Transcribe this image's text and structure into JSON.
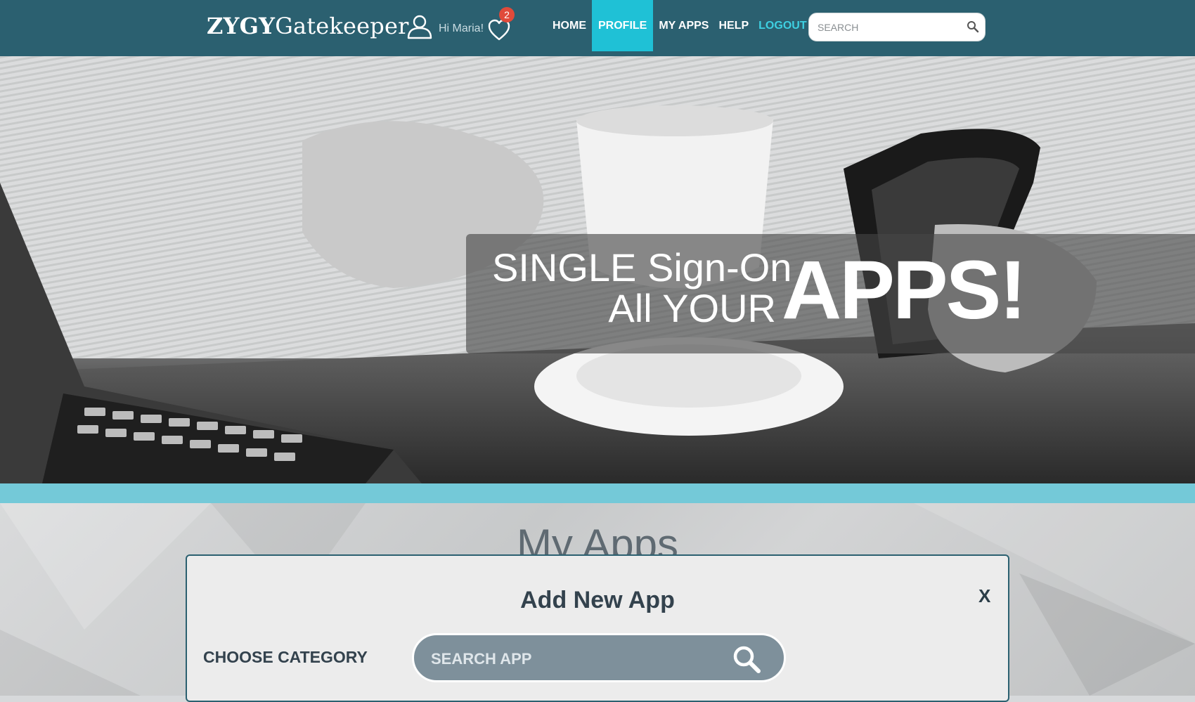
{
  "header": {
    "logo_bold": "ZYGY",
    "logo_rest": "Gatekeeper",
    "greeting": "Hi Maria!",
    "notification_count": "2",
    "nav": [
      {
        "label": "HOME"
      },
      {
        "label": "PROFILE"
      },
      {
        "label": "MY APPS"
      },
      {
        "label": "HELP"
      },
      {
        "label": "LOGOUT"
      }
    ],
    "search_placeholder": "SEARCH"
  },
  "hero": {
    "line1": "SINGLE Sign-On",
    "line2": "All YOUR",
    "big": "APPS!"
  },
  "section": {
    "title": "My Apps"
  },
  "modal": {
    "title": "Add New App",
    "close": "X",
    "category_label": "CHOOSE CATEGORY",
    "search_placeholder": "SEARCH APP"
  },
  "colors": {
    "header_bg": "#2b6070",
    "nav_active": "#1fc1d6",
    "logout": "#3ed0e2",
    "badge": "#e04a3a",
    "strip": "#74c9d8"
  },
  "icons": [
    "user-icon",
    "heart-icon",
    "search-icon"
  ]
}
